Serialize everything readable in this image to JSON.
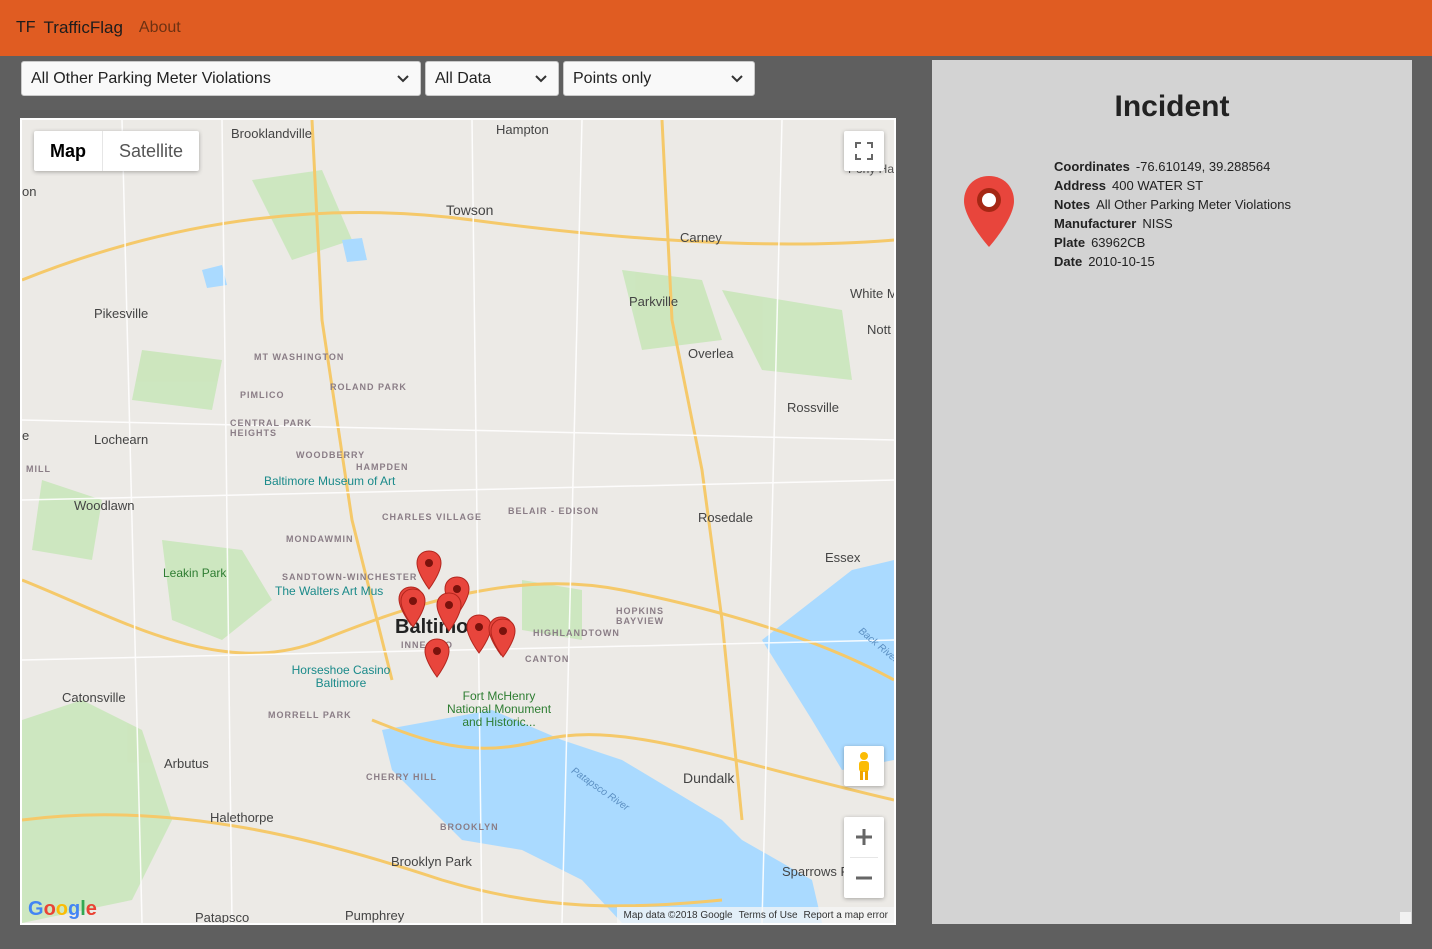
{
  "navbar": {
    "brand_abbrev": "TF",
    "brand_name": "TrafficFlag",
    "about_link": "About",
    "color": "#e05c22"
  },
  "filters": {
    "violation_type": "All Other Parking Meter Violations",
    "data_range": "All Data",
    "display_mode": "Points only"
  },
  "map": {
    "type_controls": {
      "map": "Map",
      "satellite": "Satellite",
      "selected": "Map"
    },
    "attribution": {
      "data": "Map data ©2018 Google",
      "terms": "Terms of Use",
      "report": "Report a map error"
    },
    "logo": "Google",
    "icons": [
      "fullscreen-icon",
      "pegman-icon",
      "zoom-in-icon",
      "zoom-out-icon"
    ],
    "labels": {
      "brooklandville": "Brooklandville",
      "hampton": "Hampton",
      "towson": "Towson",
      "carney": "Carney",
      "pikesville": "Pikesville",
      "parkville": "Parkville",
      "white_marsh": "White M",
      "nottingham": "Nott",
      "overlea": "Overlea",
      "mt_washington": "MT WASHINGTON",
      "roland_park": "ROLAND PARK",
      "pimlico": "PIMLICO",
      "rossville": "Rossville",
      "central_park_heights": "CENTRAL PARK HEIGHTS",
      "lochearn": "Lochearn",
      "woodberry": "WOODBERRY",
      "hampden": "HAMPDEN",
      "museum": "Baltimore Museum of Art",
      "woodlawn": "Woodlawn",
      "charles_village": "CHARLES VILLAGE",
      "belair_edison": "BELAIR - EDISON",
      "rosedale": "Rosedale",
      "mondawmin": "MONDAWMIN",
      "essex": "Essex",
      "leakin_park": "Leakin Park",
      "sandtown": "SANDTOWN-WINCHESTER",
      "walters": "The Walters Art Mus",
      "hopkins_bayview": "HOPKINS BAYVIEW",
      "baltimore": "Baltimo",
      "inner_harbor": "INNE    RBO",
      "highlandtown": "HIGHLANDTOWN",
      "canton": "CANTON",
      "back_river": "Back River",
      "horseshoe": "Horseshoe Casino Baltimore",
      "catonsville": "Catonsville",
      "fort_mchenry": "Fort McHenry National Monument and Historic...",
      "morrell_park": "MORRELL PARK",
      "arbutus": "Arbutus",
      "cherry_hill": "CHERRY HILL",
      "patapsco_river": "Patapsco River",
      "dundalk": "Dundalk",
      "halethorpe": "Halethorpe",
      "brooklyn": "BROOKLYN",
      "brooklyn_park": "Brooklyn Park",
      "sparrows": "Sparrows P",
      "patapsco": "Patapsco",
      "pumphrey": "Pumphrey",
      "edge_on": "on",
      "edge_e": "e",
      "edge_mill": "MILL",
      "edge_ha": "Pony Ha"
    }
  },
  "incident": {
    "title": "Incident",
    "marker_color": "#e8453c",
    "fields": [
      {
        "label": "Coordinates",
        "value": "-76.610149, 39.288564"
      },
      {
        "label": "Address",
        "value": "400 WATER ST"
      },
      {
        "label": "Notes",
        "value": "All Other Parking Meter Violations"
      },
      {
        "label": "Manufacturer",
        "value": "NISS"
      },
      {
        "label": "Plate",
        "value": "63962CB"
      },
      {
        "label": "Date",
        "value": "2010-10-15"
      }
    ]
  }
}
